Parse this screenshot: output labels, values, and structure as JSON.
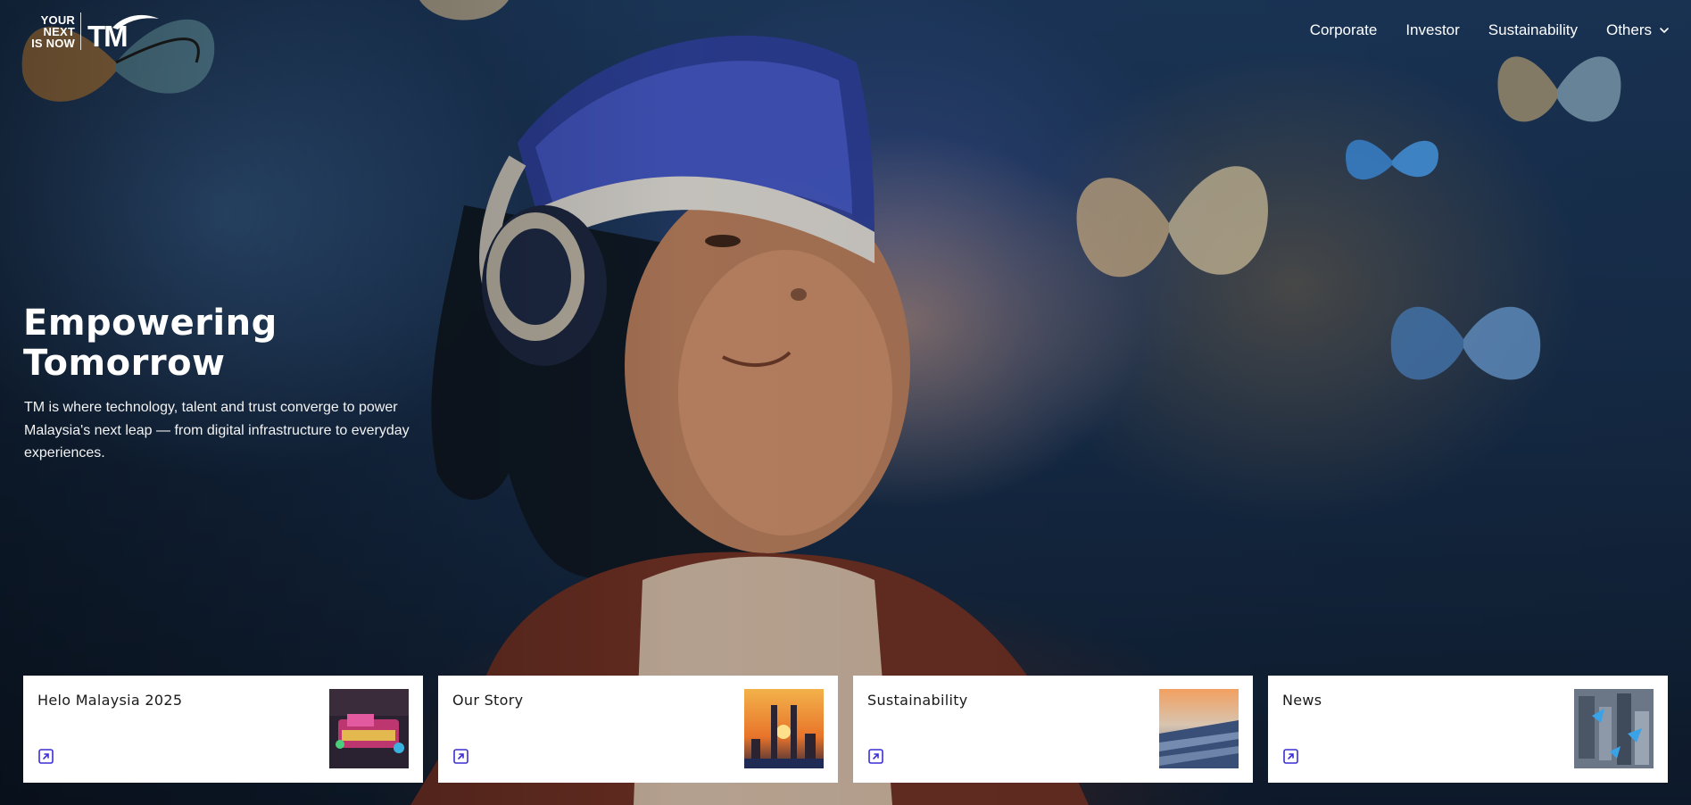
{
  "header": {
    "logo": {
      "tagline": [
        "YOUR",
        "NEXT",
        "IS NOW"
      ],
      "brand": "TM"
    },
    "nav": [
      {
        "label": "Corporate"
      },
      {
        "label": "Investor"
      },
      {
        "label": "Sustainability"
      },
      {
        "label": "Others",
        "has_dropdown": true,
        "icon": "chevron-down-icon"
      }
    ]
  },
  "hero": {
    "title_lines": [
      "Empowering",
      "Tomorrow"
    ],
    "description": "TM is where technology, talent and trust converge to power Malaysia's next leap — from digital infrastructure to everyday experiences."
  },
  "cards": [
    {
      "title": "Helo Malaysia 2025",
      "icon": "external-link-icon"
    },
    {
      "title": "Our Story",
      "icon": "external-link-icon"
    },
    {
      "title": "Sustainability",
      "icon": "external-link-icon"
    },
    {
      "title": "News",
      "icon": "external-link-icon"
    }
  ],
  "colors": {
    "accent": "#3b2fd6",
    "card_bg": "#ffffff",
    "text_on_hero": "#ffffff"
  }
}
